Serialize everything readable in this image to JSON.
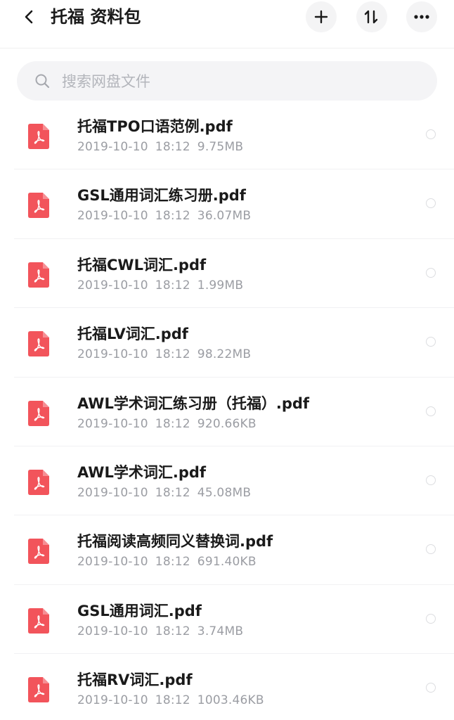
{
  "header": {
    "title": "托福 资料包",
    "back_icon": "chevron-left-icon",
    "add_icon": "plus-icon",
    "sort_icon": "sort-icon",
    "more_icon": "more-icon"
  },
  "search": {
    "placeholder": "搜索网盘文件",
    "icon": "search-icon"
  },
  "colors": {
    "pdf_icon": "#f2545b",
    "text_primary": "#1a1a1a",
    "text_secondary": "#9b9da3",
    "search_bg": "#f4f4f6"
  },
  "files": [
    {
      "name": "托福TPO口语范例.pdf",
      "date": "2019-10-10",
      "time": "18:12",
      "size": "9.75MB"
    },
    {
      "name": "GSL通用词汇练习册.pdf",
      "date": "2019-10-10",
      "time": "18:12",
      "size": "36.07MB"
    },
    {
      "name": "托福CWL词汇.pdf",
      "date": "2019-10-10",
      "time": "18:12",
      "size": "1.99MB"
    },
    {
      "name": "托福LV词汇.pdf",
      "date": "2019-10-10",
      "time": "18:12",
      "size": "98.22MB"
    },
    {
      "name": "AWL学术词汇练习册（托福）.pdf",
      "date": "2019-10-10",
      "time": "18:12",
      "size": "920.66KB"
    },
    {
      "name": "AWL学术词汇.pdf",
      "date": "2019-10-10",
      "time": "18:12",
      "size": "45.08MB"
    },
    {
      "name": "托福阅读高频同义替换词.pdf",
      "date": "2019-10-10",
      "time": "18:12",
      "size": "691.40KB"
    },
    {
      "name": "GSL通用词汇.pdf",
      "date": "2019-10-10",
      "time": "18:12",
      "size": "3.74MB"
    },
    {
      "name": "托福RV词汇.pdf",
      "date": "2019-10-10",
      "time": "18:12",
      "size": "1003.46KB"
    }
  ]
}
